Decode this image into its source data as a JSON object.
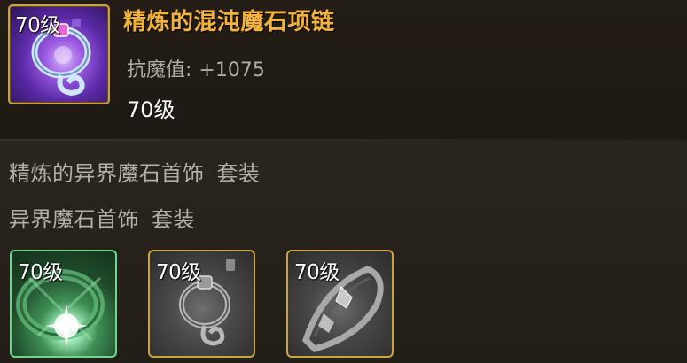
{
  "item": {
    "name": "精炼的混沌魔石项链",
    "level_badge": "70级",
    "stat_label": "抗魔值:",
    "stat_value": "+1075",
    "level_text": "70级"
  },
  "sets": [
    {
      "name": "精炼的异界魔石首饰",
      "suffix": "套装"
    },
    {
      "name": "异界魔石首饰",
      "suffix": "套装"
    }
  ],
  "slots": [
    {
      "level": "70级",
      "icon": "green-bracelet-icon"
    },
    {
      "level": "70级",
      "icon": "gray-necklace-icon"
    },
    {
      "level": "70级",
      "icon": "gray-ring-icon"
    }
  ],
  "colors": {
    "item_name": "#f3b33b",
    "stat_text": "#b3aca2",
    "set_text": "#b6afa6",
    "rarity_frame": "#c8a53a",
    "set_active_frame": "#6fd58f"
  }
}
